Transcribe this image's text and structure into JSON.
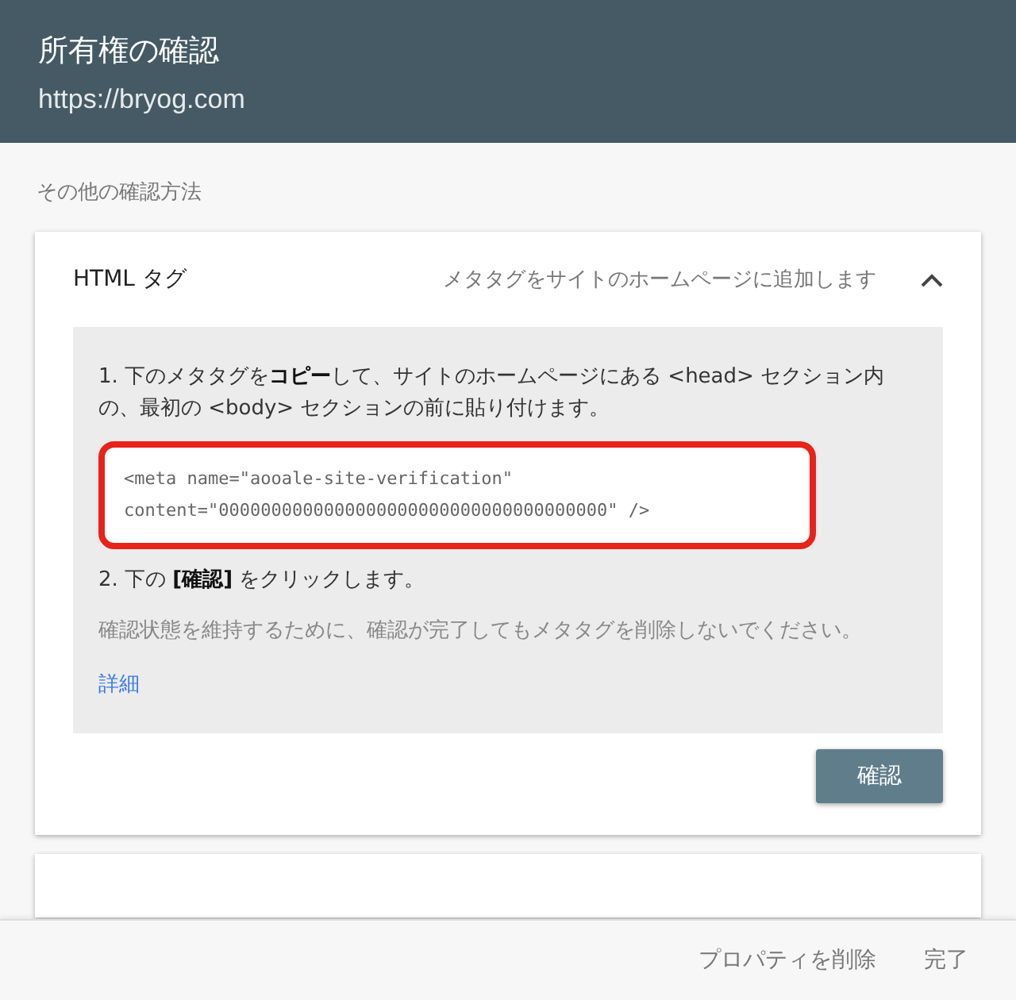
{
  "header": {
    "title": "所有権の確認",
    "url": "https://bryog.com"
  },
  "section_label": "その他の確認方法",
  "methods": [
    {
      "name": "HTML タグ",
      "description": "メタタグをサイトのホームページに追加します",
      "expanded": true,
      "steps": [
        "1. 下のメタタグを**コピー**して、サイトのホームページにある <head> セクション内の、最初の <body> セクションの前に貼り付けます。"
      ],
      "code_block": {
        "lines": [
          "<meta name=\"aooale-site-verification\"",
          "content=\"0000000000000000000000000000000000000\" />"
        ],
        "highlighted": true
      },
      "steps_after": [
        "2. 下の **[確認]** をクリックします。"
      ],
      "note": "確認状態を維持するために、確認が完了してもメタタグを削除しないでください。",
      "link": "詳細",
      "button": "確認"
    },
    {
      "expanded": false
    }
  ],
  "footer": {
    "buttons": [
      "プロパティを削除",
      "完了"
    ]
  }
}
